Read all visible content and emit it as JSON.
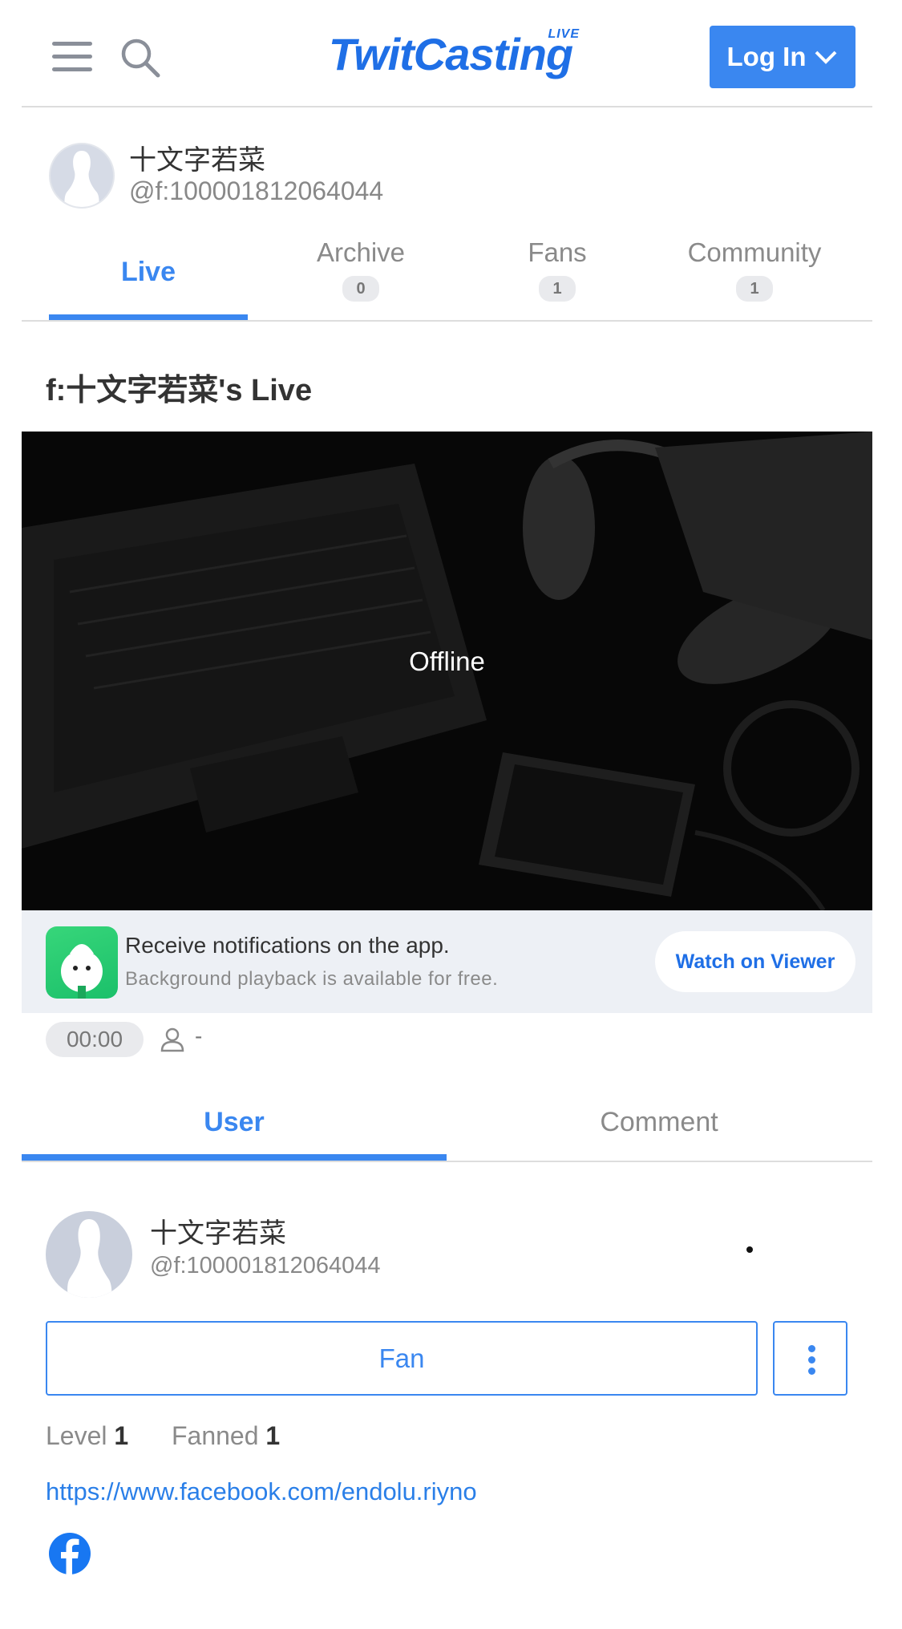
{
  "header": {
    "logo_text": "TwitCasting",
    "logo_live": "LIVE",
    "login_label": "Log In"
  },
  "profile": {
    "name": "十文字若菜",
    "handle": "@f:100001812064044"
  },
  "tabs": [
    {
      "label": "Live"
    },
    {
      "label": "Archive",
      "count": "0"
    },
    {
      "label": "Fans",
      "count": "1"
    },
    {
      "label": "Community",
      "count": "1"
    }
  ],
  "live": {
    "title": "f:十文字若菜's Live",
    "status": "Offline"
  },
  "notification": {
    "title": "Receive notifications on the app.",
    "subtitle": "Background playback is available for free.",
    "button": "Watch on Viewer"
  },
  "stream_info": {
    "timer": "00:00",
    "viewers": "-"
  },
  "sub_tabs": {
    "user": "User",
    "comment": "Comment"
  },
  "user_card": {
    "name": "十文字若菜",
    "handle": "@f:100001812064044",
    "fan_button": "Fan",
    "level_label": "Level",
    "level_value": "1",
    "fanned_label": "Fanned",
    "fanned_value": "1",
    "link": "https://www.facebook.com/endolu.riyno"
  },
  "colors": {
    "accent": "#3a87f0",
    "logo": "#1f6fe6"
  },
  "icons": [
    "menu-icon",
    "search-icon",
    "chevron-down-icon",
    "user-icon",
    "more-vertical-icon",
    "facebook-icon"
  ]
}
